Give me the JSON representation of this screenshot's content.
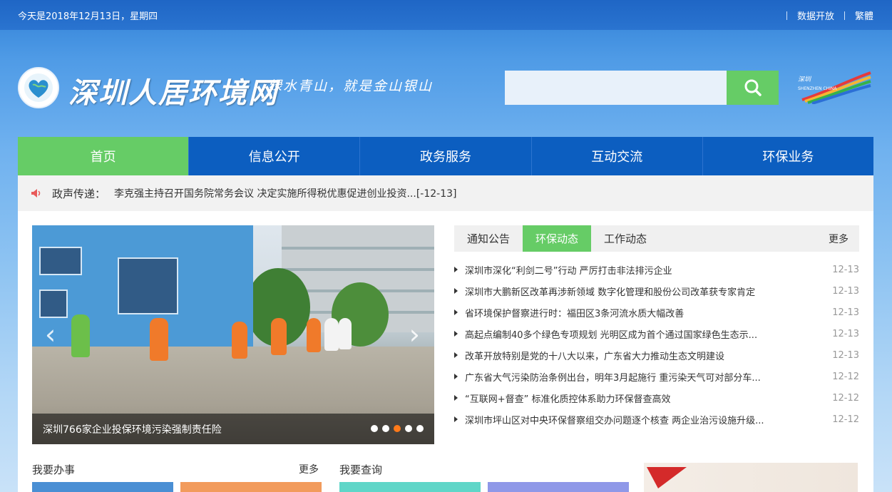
{
  "topbar": {
    "date": "今天是2018年12月13日，星期四",
    "links": [
      "数据开放",
      "繁體"
    ]
  },
  "header": {
    "site_title": "深圳人居环境网",
    "slogan": "绿水青山，就是金山银山",
    "search_placeholder": "",
    "logo_icon": "heart-globe-icon",
    "city_logo_text": "深圳 SHENZHEN CHINA"
  },
  "nav": {
    "items": [
      "首页",
      "信息公开",
      "政务服务",
      "互动交流",
      "环保业务"
    ],
    "active": "首页"
  },
  "ticker": {
    "label": "政声传递：",
    "text": "李克强主持召开国务院常务会议 决定实施所得税优惠促进创业投资...[-12-13]"
  },
  "slider": {
    "caption": "深圳766家企业投保环境污染强制责任险",
    "dots": 5,
    "active_dot": 3
  },
  "news": {
    "tabs": [
      "通知公告",
      "环保动态",
      "工作动态"
    ],
    "active_tab": "环保动态",
    "more": "更多",
    "items": [
      {
        "title": "深圳市深化“利剑二号”行动 严厉打击非法排污企业",
        "date": "12-13"
      },
      {
        "title": "深圳市大鹏新区改革再涉新领域 数字化管理和股份公司改革获专家肯定",
        "date": "12-13"
      },
      {
        "title": "省环境保护督察进行时：福田区3条河流水质大幅改善",
        "date": "12-13"
      },
      {
        "title": "高起点编制40多个绿色专项规划 光明区成为首个通过国家绿色生态示...",
        "date": "12-13"
      },
      {
        "title": "改革开放特别是党的十八大以来，广东省大力推动生态文明建设",
        "date": "12-13"
      },
      {
        "title": "广东省大气污染防治条例出台，明年3月起施行 重污染天气可对部分车...",
        "date": "12-12"
      },
      {
        "title": "“互联网+督查” 标准化质控体系助力环保督查高效",
        "date": "12-12"
      },
      {
        "title": "深圳市坪山区对中央环保督察组交办问题逐个核查 两企业治污设施升级...",
        "date": "12-12"
      }
    ]
  },
  "sections": {
    "affairs_title": "我要办事",
    "affairs_more": "更多",
    "query_title": "我要查询"
  },
  "colors": {
    "nav_bg": "#0c5ec0",
    "accent_green": "#66cc66",
    "tile_blue": "#4a8fd4",
    "tile_orange": "#f29b5c",
    "tile_teal": "#5fd6c8",
    "tile_purple": "#8f98e8"
  }
}
